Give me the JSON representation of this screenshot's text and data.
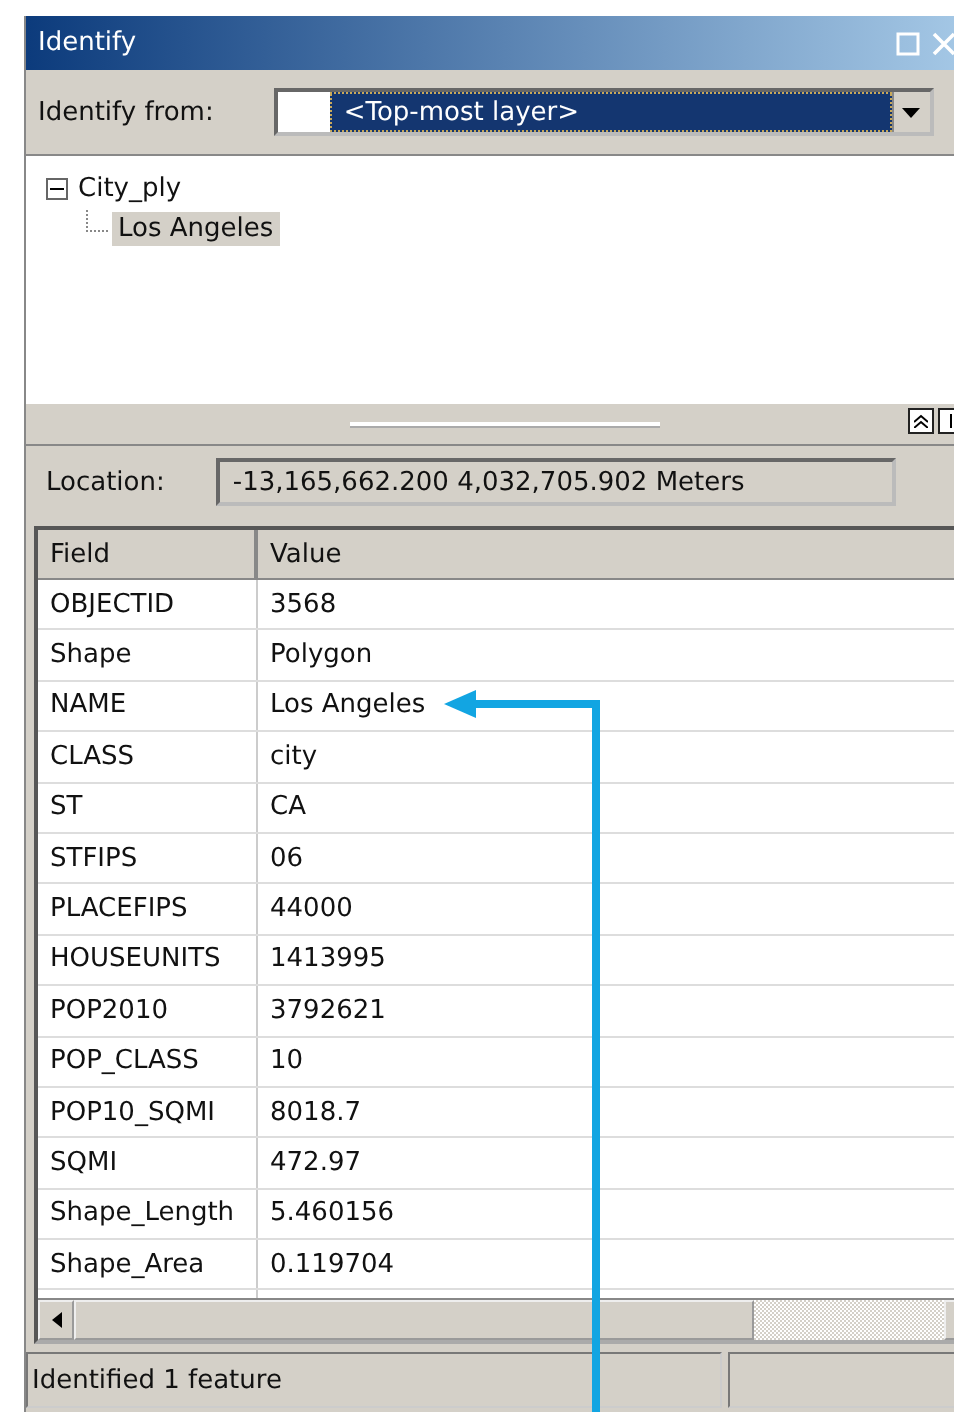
{
  "window": {
    "title": "Identify"
  },
  "identify_from": {
    "label": "Identify from:",
    "value": "<Top-most layer>"
  },
  "tree": [
    {
      "label": "City_ply",
      "expanded": true,
      "selected": false,
      "children": [
        {
          "label": "Los Angeles",
          "selected": true
        }
      ]
    }
  ],
  "location": {
    "label": "Location:",
    "value": "-13,165,662.200  4,032,705.902 Meters"
  },
  "table": {
    "columns": [
      "Field",
      "Value"
    ],
    "rows": [
      [
        "OBJECTID",
        "3568"
      ],
      [
        "Shape",
        "Polygon"
      ],
      [
        "NAME",
        "Los Angeles"
      ],
      [
        "CLASS",
        "city"
      ],
      [
        "ST",
        "CA"
      ],
      [
        "STFIPS",
        "06"
      ],
      [
        "PLACEFIPS",
        "44000"
      ],
      [
        "HOUSEUNITS",
        "1413995"
      ],
      [
        "POP2010",
        "3792621"
      ],
      [
        "POP_CLASS",
        "10"
      ],
      [
        "POP10_SQMI",
        "8018.7"
      ],
      [
        "SQMI",
        "472.97"
      ],
      [
        "Shape_Length",
        "5.460156"
      ],
      [
        "Shape_Area",
        "0.119704"
      ]
    ]
  },
  "status_bar": {
    "text": "Identified 1 feature"
  }
}
